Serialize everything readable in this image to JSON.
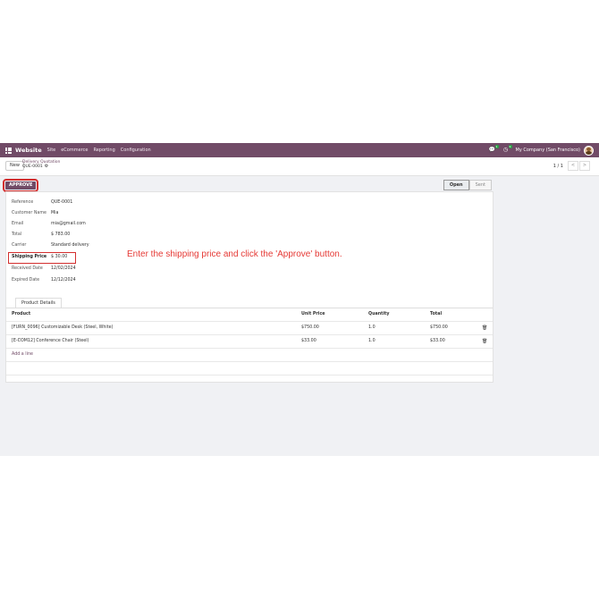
{
  "navbar": {
    "brand": "Website",
    "menu": [
      "Site",
      "eCommerce",
      "Reporting",
      "Configuration"
    ],
    "chat_badge": "1",
    "activity_badge": "9",
    "company": "My Company (San Francisco)"
  },
  "control": {
    "new_label": "New",
    "breadcrumb_parent": "Delivery Quotation",
    "breadcrumb_current": "QUE-0001",
    "pager": "1 / 1",
    "prev": "<",
    "next": ">"
  },
  "status": {
    "approve_label": "APPROVE",
    "stages": [
      "Open",
      "Sent"
    ]
  },
  "fields": [
    {
      "label": "Reference",
      "value": "QUE-0001"
    },
    {
      "label": "Customer Name",
      "value": "Mia"
    },
    {
      "label": "Email",
      "value": "mia@gmail.com"
    },
    {
      "label": "Total",
      "value": "$ 783.00"
    },
    {
      "label": "Carrier",
      "value": "Standard delivery"
    },
    {
      "label": "Shipping Price",
      "value": "$ 30.00"
    },
    {
      "label": "Received Date",
      "value": "12/02/2024"
    },
    {
      "label": "Expired Date",
      "value": "12/12/2024"
    }
  ],
  "instruction": "Enter the shipping price and click the 'Approve' button.",
  "tab_label": "Product Details",
  "table": {
    "headers": [
      "Product",
      "Unit Price",
      "Quantity",
      "Total"
    ],
    "rows": [
      {
        "product": "[FURN_0096] Customizable Desk (Steel, White)",
        "unit_price": "$750.00",
        "quantity": "1.0",
        "total": "$750.00"
      },
      {
        "product": "[E-COM12] Conference Chair (Steel)",
        "unit_price": "$33.00",
        "quantity": "1.0",
        "total": "$33.00"
      }
    ],
    "add_line": "Add a line"
  },
  "colors": {
    "brand": "#714b67",
    "highlight": "#d32f2f",
    "instruction": "#e53935"
  }
}
